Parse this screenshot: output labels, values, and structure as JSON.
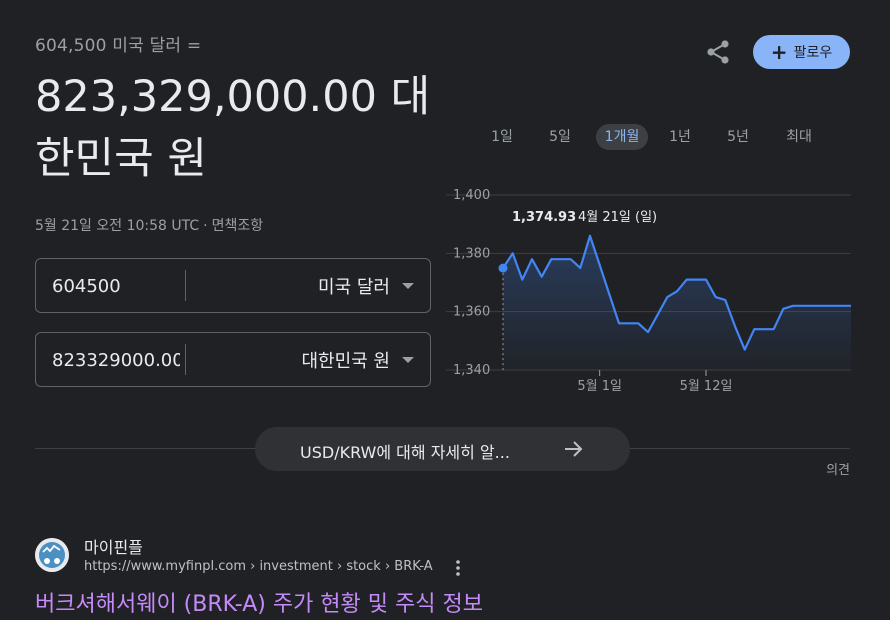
{
  "converter": {
    "from_line": "604,500 미국 달러 =",
    "result_value": "823,329,000.00 대한민국 원",
    "timestamp": "5월 21일 오전 10:58 UTC",
    "disclaimer_link": "면책조항",
    "input_from_value": "604500",
    "input_to_value": "823329000.00",
    "currency_from": "미국 달러",
    "currency_to": "대한민국 원"
  },
  "header": {
    "share_icon": "share-icon",
    "follow_label": "팔로우"
  },
  "range_tabs": [
    {
      "label": "1일",
      "active": false
    },
    {
      "label": "5일",
      "active": false
    },
    {
      "label": "1개월",
      "active": true
    },
    {
      "label": "1년",
      "active": false
    },
    {
      "label": "5년",
      "active": false
    },
    {
      "label": "최대",
      "active": false
    }
  ],
  "chart_data": {
    "type": "area",
    "ylim": [
      1340,
      1400
    ],
    "y_ticks": [
      "1,400",
      "1,380",
      "1,360",
      "1,340"
    ],
    "y_tick_values": [
      1400,
      1380,
      1360,
      1340
    ],
    "x_labels": [
      {
        "label": "5월 1일",
        "x": 10
      },
      {
        "label": "5월 12일",
        "x": 21
      }
    ],
    "x_range": [
      0,
      36
    ],
    "x": [
      0,
      1,
      2,
      3,
      4,
      5,
      6,
      7,
      8,
      9,
      10,
      11,
      12,
      13,
      14,
      15,
      16,
      17,
      18,
      19,
      20,
      21,
      22,
      23,
      24,
      25,
      26,
      27,
      28,
      29,
      30,
      31,
      32,
      33,
      34,
      35,
      36
    ],
    "values": [
      1374.93,
      1380,
      1371,
      1378,
      1372,
      1378,
      1378,
      1378,
      1375,
      1386,
      1376,
      1366,
      1356,
      1356,
      1356,
      1353,
      1359,
      1365,
      1367,
      1371,
      1371,
      1371,
      1365,
      1364,
      1355,
      1347,
      1354,
      1354,
      1354,
      1361,
      1362,
      1362,
      1362,
      1362,
      1362,
      1362,
      1362
    ],
    "tooltip": {
      "value": "1,374.93",
      "date": "4월 21일 (일)",
      "index": 0
    },
    "line_color": "#4285f4",
    "grid": true
  },
  "more_info": {
    "label": "USD/KRW에 대해 자세히 알...",
    "feedback": "의견"
  },
  "result": {
    "site_name": "마이핀플",
    "url": "https://www.myfinpl.com › investment › stock › BRK-A",
    "title": "버크셔해서웨이 (BRK-A) 주가 현황 및 주식 정보"
  }
}
